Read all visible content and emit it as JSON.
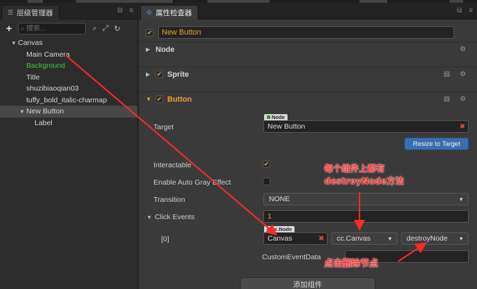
{
  "hierarchy": {
    "tab_label": "层级管理器",
    "search_placeholder": "搜索...",
    "tree": [
      {
        "label": "Canvas",
        "depth": 0,
        "expanded": true
      },
      {
        "label": "Main Camera",
        "depth": 1
      },
      {
        "label": "Background",
        "depth": 1,
        "color": "#43c443"
      },
      {
        "label": "Title",
        "depth": 1
      },
      {
        "label": "shuzibiaoqian03",
        "depth": 1
      },
      {
        "label": "tuffy_bold_italic-charmap",
        "depth": 1
      },
      {
        "label": "New Button",
        "depth": 1,
        "expanded": true,
        "selected": true
      },
      {
        "label": "Label",
        "depth": 2
      }
    ]
  },
  "inspector": {
    "tab_label": "属性检查器",
    "node_name": "New Button",
    "sections": {
      "node": "Node",
      "sprite": "Sprite",
      "button": "Button"
    },
    "props": {
      "target_label": "Target",
      "target_pill": "Node",
      "target_value": "New Button",
      "resize_button": "Resize to Target",
      "interactable_label": "Interactable",
      "gray_label": "Enable Auto Gray Effect",
      "transition_label": "Transition",
      "transition_value": "NONE",
      "click_events_label": "Click Events",
      "click_events_count": "1",
      "event_index": "[0]",
      "event_pill": "cc.Node",
      "event_node": "Canvas",
      "event_component": "cc.Canvas",
      "event_handler": "destroyNode",
      "custom_data_label": "CustomEventData",
      "custom_data_value": ""
    },
    "add_component": "添加组件"
  },
  "annotations": {
    "note1_line1": "每个组件上都有",
    "note1_line2": "destroyNode方法",
    "note2": "点击删除节点"
  },
  "colors": {
    "accent_orange": "#f0a133",
    "annotation_red": "#ff2a2a",
    "button_blue": "#3a6fb0"
  }
}
